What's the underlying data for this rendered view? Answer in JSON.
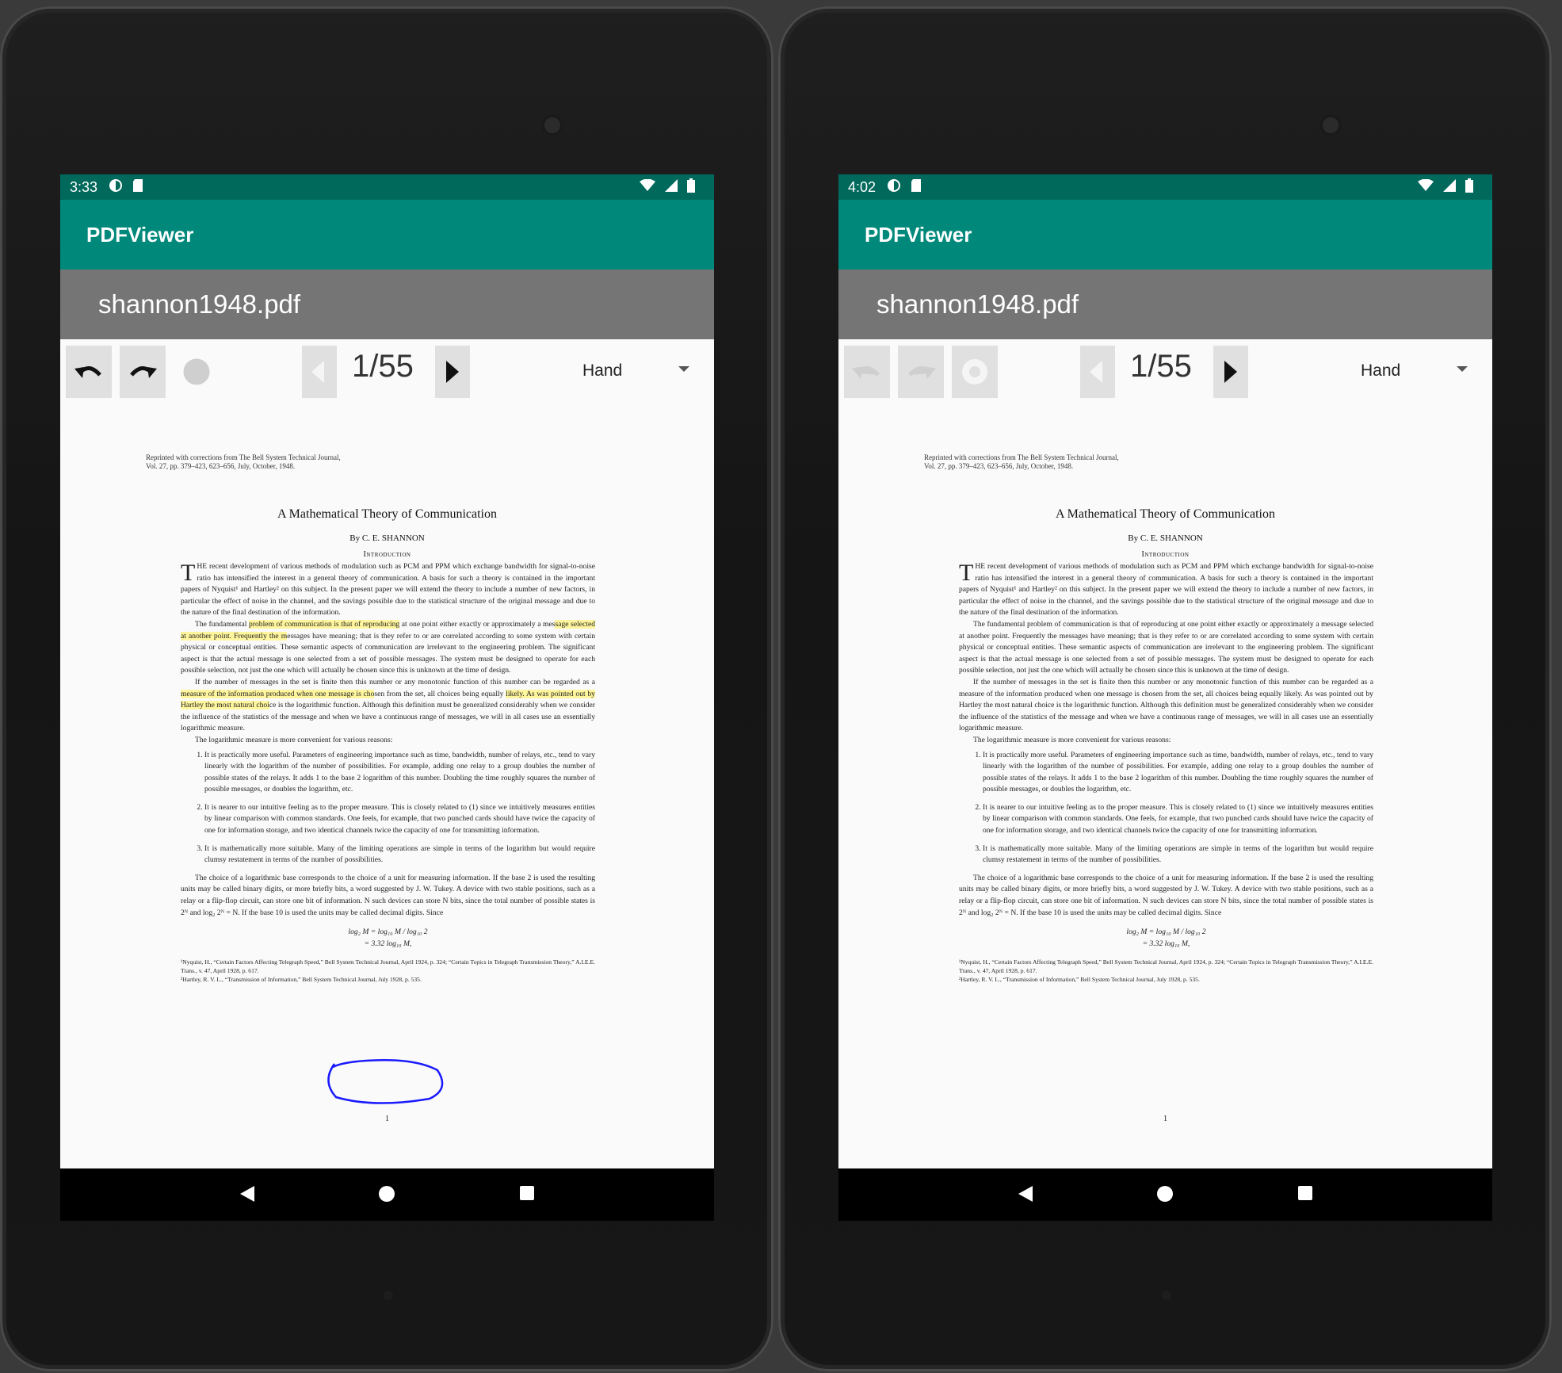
{
  "devices": [
    {
      "status": {
        "time": "3:33"
      },
      "app_title": "PDFViewer",
      "file_name": "shannon1948.pdf",
      "toolbar": {
        "page_indicator": "1/55",
        "mode": "Hand",
        "undo_enabled": true,
        "redo_enabled": true
      },
      "annotations": {
        "highlights": true,
        "ink_circle": true
      }
    },
    {
      "status": {
        "time": "4:02"
      },
      "app_title": "PDFViewer",
      "file_name": "shannon1948.pdf",
      "toolbar": {
        "page_indicator": "1/55",
        "mode": "Hand",
        "undo_enabled": false,
        "redo_enabled": false
      },
      "annotations": {
        "highlights": false,
        "ink_circle": false
      }
    }
  ],
  "document": {
    "header_line1": "Reprinted with corrections from The Bell System Technical Journal,",
    "header_line2": "Vol. 27, pp. 379–423, 623–656, July, October, 1948.",
    "title": "A Mathematical Theory of Communication",
    "author": "By C. E. SHANNON",
    "section": "Introduction",
    "p1": "HE recent development of various methods of modulation such as PCM and PPM which exchange bandwidth for signal-to-noise ratio has intensified the interest in a general theory of communication. A basis for such a theory is contained in the important papers of Nyquist¹ and Hartley² on this subject. In the present paper we will extend the theory to include a number of new factors, in particular the effect of noise in the channel, and the savings possible due to the statistical structure of the original message and due to the nature of the final destination of the information.",
    "p1_dropcap": "T",
    "p2_a": "The fundamental ",
    "p2_h1": "problem of communication is that of reproducing",
    "p2_b": " at one point either exactly or approximately a mes",
    "p2_h2": "sage selected at another point. Frequently the m",
    "p2_c": "essages have meaning; that is they refer to or are correlated according to some system with certain physical or conceptual entities. These semantic aspects of communication are irrelevant to the engineering problem. The significant aspect is that the actual message is one selected from a set of possible messages. The system must be designed to operate for each possible selection, not just the one which will actually be chosen since this is unknown at the time of design.",
    "p3_a": "If the number of messages in the set is finite then this number or any monotonic function of this number can be regarded as a ",
    "p3_h1": "measure of the information produced when one message is cho",
    "p3_b": "sen from the set, all choices being equally ",
    "p3_h2": "likely. As was pointed out by Hartley the most natural choi",
    "p3_c": "ce is the logarithmic function. Although this definition must be generalized considerably when we consider the influence of the statistics of the message and when we have a continuous range of messages, we will in all cases use an essentially logarithmic measure.",
    "p4": "The logarithmic measure is more convenient for various reasons:",
    "list": [
      "It is practically more useful. Parameters of engineering importance such as time, bandwidth, number of relays, etc., tend to vary linearly with the logarithm of the number of possibilities. For example, adding one relay to a group doubles the number of possible states of the relays. It adds 1 to the base 2 logarithm of this number. Doubling the time roughly squares the number of possible messages, or doubles the logarithm, etc.",
      "It is nearer to our intuitive feeling as to the proper measure. This is closely related to (1) since we intuitively measures entities by linear comparison with common standards. One feels, for example, that two punched cards should have twice the capacity of one for information storage, and two identical channels twice the capacity of one for transmitting information.",
      "It is mathematically more suitable. Many of the limiting operations are simple in terms of the logarithm but would require clumsy restatement in terms of the number of possibilities."
    ],
    "p5": "The choice of a logarithmic base corresponds to the choice of a unit for measuring information. If the base 2 is used the resulting units may be called binary digits, or more briefly bits, a word suggested by J. W. Tukey. A device with two stable positions, such as a relay or a flip-flop circuit, can store one bit of information. N such devices can store N bits, since the total number of possible states is 2ᴺ and log₂ 2ᴺ = N. If the base 10 is used the units may be called decimal digits. Since",
    "eq_line1": "log₂ M = log₁₀ M / log₁₀ 2",
    "eq_line2": "= 3.32 log₁₀ M,",
    "footnote1": "¹Nyquist, H., “Certain Factors Affecting Telegraph Speed,” Bell System Technical Journal, April 1924, p. 324; “Certain Topics in Telegraph Transmission Theory,” A.I.E.E. Trans., v. 47, April 1928, p. 617.",
    "footnote2": "²Hartley, R. V. L., “Transmission of Information,” Bell System Technical Journal, July 1928, p. 535.",
    "page_number": "1"
  },
  "colors": {
    "status_bar": "#00695c",
    "app_bar": "#00897b",
    "file_bar": "#757575",
    "highlight": "#fff59d",
    "ink": "#1a1aff"
  },
  "icons": [
    "undo-icon",
    "redo-icon",
    "settings-icon",
    "prev-page-icon",
    "next-page-icon",
    "dropdown-arrow-icon",
    "wifi-icon",
    "signal-icon",
    "battery-icon",
    "back-icon",
    "home-icon",
    "recents-icon"
  ]
}
